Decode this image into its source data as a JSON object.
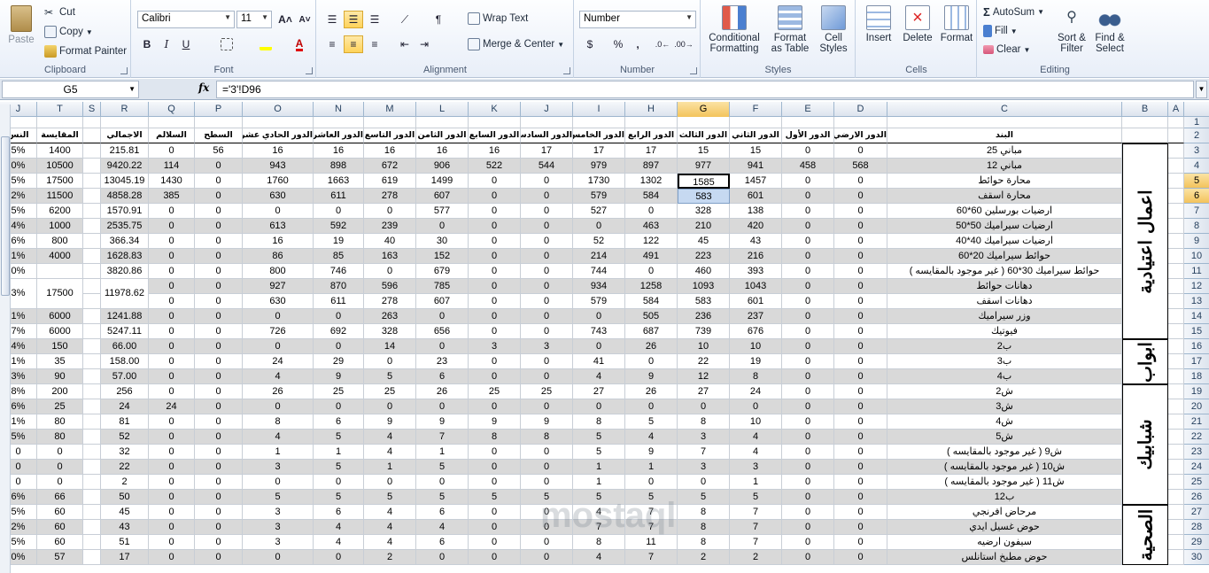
{
  "ribbon": {
    "clipboard": {
      "label": "Clipboard",
      "paste": "Paste",
      "cut": "Cut",
      "copy": "Copy",
      "format_painter": "Format Painter"
    },
    "font": {
      "label": "Font",
      "name": "Calibri",
      "size": "11",
      "bold": "B",
      "italic": "I",
      "underline": "U"
    },
    "alignment": {
      "label": "Alignment",
      "wrap_text": "Wrap Text",
      "merge_center": "Merge & Center"
    },
    "number": {
      "label": "Number",
      "format": "Number",
      "currency": "$",
      "percent": "%",
      "comma": ","
    },
    "styles": {
      "label": "Styles",
      "conditional": [
        "Conditional",
        "Formatting"
      ],
      "format_table": [
        "Format",
        "as Table"
      ],
      "cell_styles": [
        "Cell",
        "Styles"
      ]
    },
    "cells": {
      "label": "Cells",
      "insert": "Insert",
      "delete": "Delete",
      "format": "Format"
    },
    "editing": {
      "label": "Editing",
      "autosum": "AutoSum",
      "fill": "Fill",
      "clear": "Clear",
      "sort_filter": [
        "Sort &",
        "Filter"
      ],
      "find_select": [
        "Find &",
        "Select"
      ]
    }
  },
  "formula_bar": {
    "name_box": "G5",
    "fx": "fx",
    "formula": "='3'!D96"
  },
  "columns": [
    "J",
    "T",
    "S",
    "R",
    "Q",
    "P",
    "O",
    "N",
    "M",
    "L",
    "K",
    "J",
    "I",
    "H",
    "G",
    "F",
    "E",
    "D",
    "C",
    "B",
    "A"
  ],
  "selected_column": "G",
  "selected_rows": [
    "5",
    "6"
  ],
  "row_numbers": [
    "1",
    "2",
    "3",
    "4",
    "5",
    "6",
    "7",
    "8",
    "9",
    "10",
    "11",
    "12",
    "13",
    "14",
    "15",
    "16",
    "17",
    "18",
    "19",
    "20",
    "21",
    "22",
    "23",
    "24",
    "25",
    "26",
    "27",
    "28",
    "29",
    "30"
  ],
  "headers": {
    "J": "النس",
    "T": "المقايسة",
    "R": "الاجمالي",
    "Q": "السلالم",
    "P": "السطح",
    "O": "الدور الحادي عشر",
    "N": "الدور العاشر",
    "M": "الدور التاسع",
    "L": "الدور الثامن",
    "K": "الدور السابع",
    "J2": "الدور السادس",
    "I": "الدور الخامس",
    "H": "الدور الرابع",
    "G": "الدور الثالث",
    "F": "الدور الثاني",
    "E": "الدور الأول",
    "D": "الدور الارضي",
    "C": "البند"
  },
  "rows": [
    {
      "r": "3",
      "J": "5%",
      "T": "1400",
      "R": "215.81",
      "Q": "0",
      "P": "56",
      "O": "16",
      "N": "16",
      "M": "16",
      "L": "16",
      "K": "16",
      "J2": "17",
      "I": "17",
      "H": "17",
      "G": "15",
      "F": "15",
      "E": "0",
      "D": "0",
      "C": "مباني 25"
    },
    {
      "r": "4",
      "J": "0%",
      "T": "10500",
      "R": "9420.22",
      "Q": "114",
      "P": "0",
      "O": "943",
      "N": "898",
      "M": "672",
      "L": "906",
      "K": "522",
      "J2": "544",
      "I": "979",
      "H": "897",
      "G": "977",
      "F": "941",
      "E": "458",
      "D": "568",
      "C": "مباني 12"
    },
    {
      "r": "5",
      "J": "5%",
      "T": "17500",
      "R": "13045.19",
      "Q": "1430",
      "P": "0",
      "O": "1760",
      "N": "1663",
      "M": "619",
      "L": "1499",
      "K": "0",
      "J2": "0",
      "I": "1730",
      "H": "1302",
      "G": "1585",
      "F": "1457",
      "E": "0",
      "D": "0",
      "C": "محارة حوائط"
    },
    {
      "r": "6",
      "J": "2%",
      "T": "11500",
      "R": "4858.28",
      "Q": "385",
      "P": "0",
      "O": "630",
      "N": "611",
      "M": "278",
      "L": "607",
      "K": "0",
      "J2": "0",
      "I": "579",
      "H": "584",
      "G": "583",
      "F": "601",
      "E": "0",
      "D": "0",
      "C": "محارة اسقف"
    },
    {
      "r": "7",
      "J": "5%",
      "T": "6200",
      "R": "1570.91",
      "Q": "0",
      "P": "0",
      "O": "0",
      "N": "0",
      "M": "0",
      "L": "577",
      "K": "0",
      "J2": "0",
      "I": "527",
      "H": "0",
      "G": "328",
      "F": "138",
      "E": "0",
      "D": "0",
      "C": "ارضيات بورسلين 60*60"
    },
    {
      "r": "8",
      "J": "4%",
      "T": "1000",
      "R": "2535.75",
      "Q": "0",
      "P": "0",
      "O": "613",
      "N": "592",
      "M": "239",
      "L": "0",
      "K": "0",
      "J2": "0",
      "I": "0",
      "H": "463",
      "G": "210",
      "F": "420",
      "E": "0",
      "D": "0",
      "C": "ارضيات سيراميك 50*50"
    },
    {
      "r": "9",
      "J": "6%",
      "T": "800",
      "R": "366.34",
      "Q": "0",
      "P": "0",
      "O": "16",
      "N": "19",
      "M": "40",
      "L": "30",
      "K": "0",
      "J2": "0",
      "I": "52",
      "H": "122",
      "G": "45",
      "F": "43",
      "E": "0",
      "D": "0",
      "C": "ارضيات سيراميك 40*40"
    },
    {
      "r": "10",
      "J": "1%",
      "T": "4000",
      "R": "1628.83",
      "Q": "0",
      "P": "0",
      "O": "86",
      "N": "85",
      "M": "163",
      "L": "152",
      "K": "0",
      "J2": "0",
      "I": "214",
      "H": "491",
      "G": "223",
      "F": "216",
      "E": "0",
      "D": "0",
      "C": "حوائط سيراميك 20*60"
    },
    {
      "r": "11",
      "J": "0%",
      "T": "",
      "R": "3820.86",
      "Q": "0",
      "P": "0",
      "O": "800",
      "N": "746",
      "M": "0",
      "L": "679",
      "K": "0",
      "J2": "0",
      "I": "744",
      "H": "0",
      "G": "460",
      "F": "393",
      "E": "0",
      "D": "0",
      "C": "حوائط سيراميك 30*60 ( غير موجود بالمقايسه )"
    },
    {
      "r": "12",
      "J": "3%",
      "T": "17500",
      "R": "11978.62",
      "Q": "0",
      "P": "0",
      "O": "927",
      "N": "870",
      "M": "596",
      "L": "785",
      "K": "0",
      "J2": "0",
      "I": "934",
      "H": "1258",
      "G": "1093",
      "F": "1043",
      "E": "0",
      "D": "0",
      "C": "دهانات حوائط"
    },
    {
      "r": "13",
      "J": "",
      "T": "",
      "R": "",
      "Q": "0",
      "P": "0",
      "O": "630",
      "N": "611",
      "M": "278",
      "L": "607",
      "K": "0",
      "J2": "0",
      "I": "579",
      "H": "584",
      "G": "583",
      "F": "601",
      "E": "0",
      "D": "0",
      "C": "دهانات اسقف"
    },
    {
      "r": "14",
      "J": "1%",
      "T": "6000",
      "R": "1241.88",
      "Q": "0",
      "P": "0",
      "O": "0",
      "N": "0",
      "M": "263",
      "L": "0",
      "K": "0",
      "J2": "0",
      "I": "0",
      "H": "505",
      "G": "236",
      "F": "237",
      "E": "0",
      "D": "0",
      "C": "وزر سيراميك"
    },
    {
      "r": "15",
      "J": "7%",
      "T": "6000",
      "R": "5247.11",
      "Q": "0",
      "P": "0",
      "O": "726",
      "N": "692",
      "M": "328",
      "L": "656",
      "K": "0",
      "J2": "0",
      "I": "743",
      "H": "687",
      "G": "739",
      "F": "676",
      "E": "0",
      "D": "0",
      "C": "فيوتيك"
    },
    {
      "r": "16",
      "J": "4%",
      "T": "150",
      "R": "66.00",
      "Q": "0",
      "P": "0",
      "O": "0",
      "N": "0",
      "M": "14",
      "L": "0",
      "K": "3",
      "J2": "3",
      "I": "0",
      "H": "26",
      "G": "10",
      "F": "10",
      "E": "0",
      "D": "0",
      "C": "ب2"
    },
    {
      "r": "17",
      "J": "1%",
      "T": "35",
      "R": "158.00",
      "Q": "0",
      "P": "0",
      "O": "24",
      "N": "29",
      "M": "0",
      "L": "23",
      "K": "0",
      "J2": "0",
      "I": "41",
      "H": "0",
      "G": "22",
      "F": "19",
      "E": "0",
      "D": "0",
      "C": "ب3"
    },
    {
      "r": "18",
      "J": "3%",
      "T": "90",
      "R": "57.00",
      "Q": "0",
      "P": "0",
      "O": "4",
      "N": "9",
      "M": "5",
      "L": "6",
      "K": "0",
      "J2": "0",
      "I": "4",
      "H": "9",
      "G": "12",
      "F": "8",
      "E": "0",
      "D": "0",
      "C": "ب4"
    },
    {
      "r": "19",
      "J": "8%",
      "T": "200",
      "R": "256",
      "Q": "0",
      "P": "0",
      "O": "26",
      "N": "25",
      "M": "25",
      "L": "26",
      "K": "25",
      "J2": "25",
      "I": "27",
      "H": "26",
      "G": "27",
      "F": "24",
      "E": "0",
      "D": "0",
      "C": "ش2"
    },
    {
      "r": "20",
      "J": "6%",
      "T": "25",
      "R": "24",
      "Q": "24",
      "P": "0",
      "O": "0",
      "N": "0",
      "M": "0",
      "L": "0",
      "K": "0",
      "J2": "0",
      "I": "0",
      "H": "0",
      "G": "0",
      "F": "0",
      "E": "0",
      "D": "0",
      "C": "ش3"
    },
    {
      "r": "21",
      "J": "1%",
      "T": "80",
      "R": "81",
      "Q": "0",
      "P": "0",
      "O": "8",
      "N": "6",
      "M": "9",
      "L": "9",
      "K": "9",
      "J2": "9",
      "I": "8",
      "H": "5",
      "G": "8",
      "F": "10",
      "E": "0",
      "D": "0",
      "C": "ش4"
    },
    {
      "r": "22",
      "J": "5%",
      "T": "80",
      "R": "52",
      "Q": "0",
      "P": "0",
      "O": "4",
      "N": "5",
      "M": "4",
      "L": "7",
      "K": "8",
      "J2": "8",
      "I": "5",
      "H": "4",
      "G": "3",
      "F": "4",
      "E": "0",
      "D": "0",
      "C": "ش5"
    },
    {
      "r": "23",
      "J": "0",
      "T": "0",
      "R": "32",
      "Q": "0",
      "P": "0",
      "O": "1",
      "N": "1",
      "M": "4",
      "L": "1",
      "K": "0",
      "J2": "0",
      "I": "5",
      "H": "9",
      "G": "7",
      "F": "4",
      "E": "0",
      "D": "0",
      "C": "ش9 ( غير موجود بالمقايسه )"
    },
    {
      "r": "24",
      "J": "0",
      "T": "0",
      "R": "22",
      "Q": "0",
      "P": "0",
      "O": "3",
      "N": "5",
      "M": "1",
      "L": "5",
      "K": "0",
      "J2": "0",
      "I": "1",
      "H": "1",
      "G": "3",
      "F": "3",
      "E": "0",
      "D": "0",
      "C": "ش10 ( غير موجود بالمقايسه )"
    },
    {
      "r": "25",
      "J": "0",
      "T": "0",
      "R": "2",
      "Q": "0",
      "P": "0",
      "O": "0",
      "N": "0",
      "M": "0",
      "L": "0",
      "K": "0",
      "J2": "0",
      "I": "1",
      "H": "0",
      "G": "0",
      "F": "1",
      "E": "0",
      "D": "0",
      "C": "ش11 ( غير موجود بالمقايسه )"
    },
    {
      "r": "26",
      "J": "6%",
      "T": "66",
      "R": "50",
      "Q": "0",
      "P": "0",
      "O": "5",
      "N": "5",
      "M": "5",
      "L": "5",
      "K": "5",
      "J2": "5",
      "I": "5",
      "H": "5",
      "G": "5",
      "F": "5",
      "E": "0",
      "D": "0",
      "C": "ب12"
    },
    {
      "r": "27",
      "J": "5%",
      "T": "60",
      "R": "45",
      "Q": "0",
      "P": "0",
      "O": "3",
      "N": "6",
      "M": "4",
      "L": "6",
      "K": "0",
      "J2": "0",
      "I": "4",
      "H": "7",
      "G": "8",
      "F": "7",
      "E": "0",
      "D": "0",
      "C": "مرحاض افرنجي"
    },
    {
      "r": "28",
      "J": "2%",
      "T": "60",
      "R": "43",
      "Q": "0",
      "P": "0",
      "O": "3",
      "N": "4",
      "M": "4",
      "L": "4",
      "K": "0",
      "J2": "0",
      "I": "7",
      "H": "7",
      "G": "8",
      "F": "7",
      "E": "0",
      "D": "0",
      "C": "حوض غسيل ايدي"
    },
    {
      "r": "29",
      "J": "5%",
      "T": "60",
      "R": "51",
      "Q": "0",
      "P": "0",
      "O": "3",
      "N": "4",
      "M": "4",
      "L": "6",
      "K": "0",
      "J2": "0",
      "I": "8",
      "H": "11",
      "G": "8",
      "F": "7",
      "E": "0",
      "D": "0",
      "C": "سيفون ارضيه"
    },
    {
      "r": "30",
      "J": "0%",
      "T": "57",
      "R": "17",
      "Q": "0",
      "P": "0",
      "O": "0",
      "N": "0",
      "M": "2",
      "L": "0",
      "K": "0",
      "J2": "0",
      "I": "4",
      "H": "7",
      "G": "2",
      "F": "2",
      "E": "0",
      "D": "0",
      "C": "حوض مطبخ استانلس"
    }
  ],
  "groups": [
    {
      "label": "اعمال اعتيادية",
      "from": 3,
      "to": 15
    },
    {
      "label": "ابواب",
      "from": 16,
      "to": 18
    },
    {
      "label": "شبابيك",
      "from": 19,
      "to": 26
    },
    {
      "label": "الصحية",
      "from": 27,
      "to": 30
    }
  ],
  "watermark": "mostaql"
}
